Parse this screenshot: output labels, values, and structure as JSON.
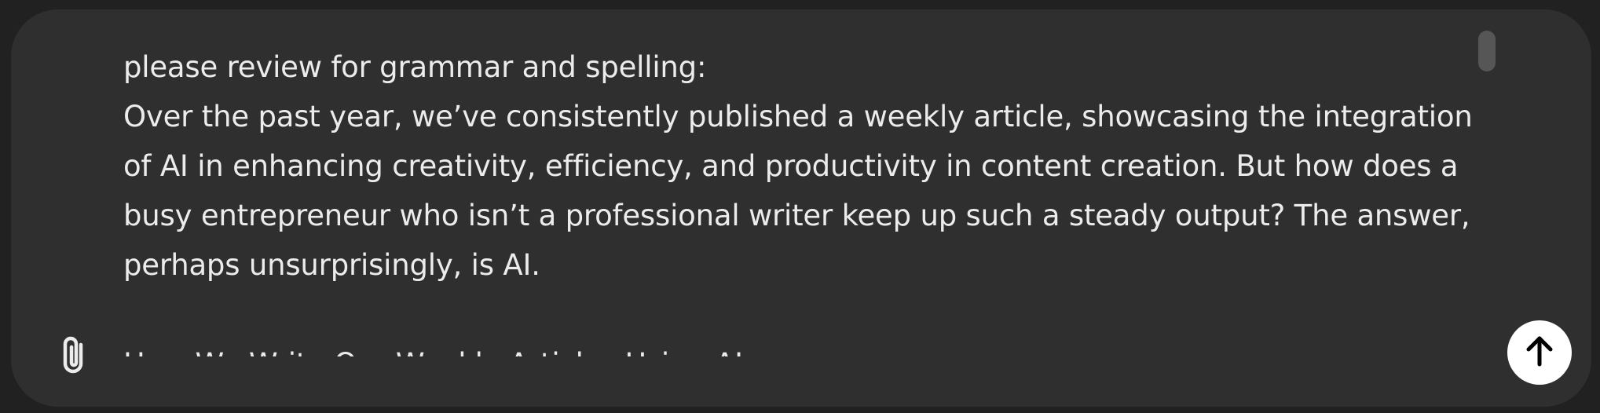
{
  "composer": {
    "prompt_lines": [
      "please review for grammar and spelling:"
    ],
    "paragraph": "Over the past year, we’ve consistently published a weekly article, showcasing the integration of AI in enhancing creativity, efficiency, and productivity in content creation. But how does a busy entrepreneur who isn’t a professional writer keep up such a steady output? The answer, perhaps unsurprisingly, is AI.",
    "heading_line": "How We Write Our Weekly Articles Using AI",
    "attach_icon": "paperclip-icon",
    "send_icon": "arrow-up-icon"
  },
  "colors": {
    "page_background": "#212121",
    "composer_background": "#2f2f2f",
    "text": "#ececec",
    "send_button": "#ffffff"
  }
}
